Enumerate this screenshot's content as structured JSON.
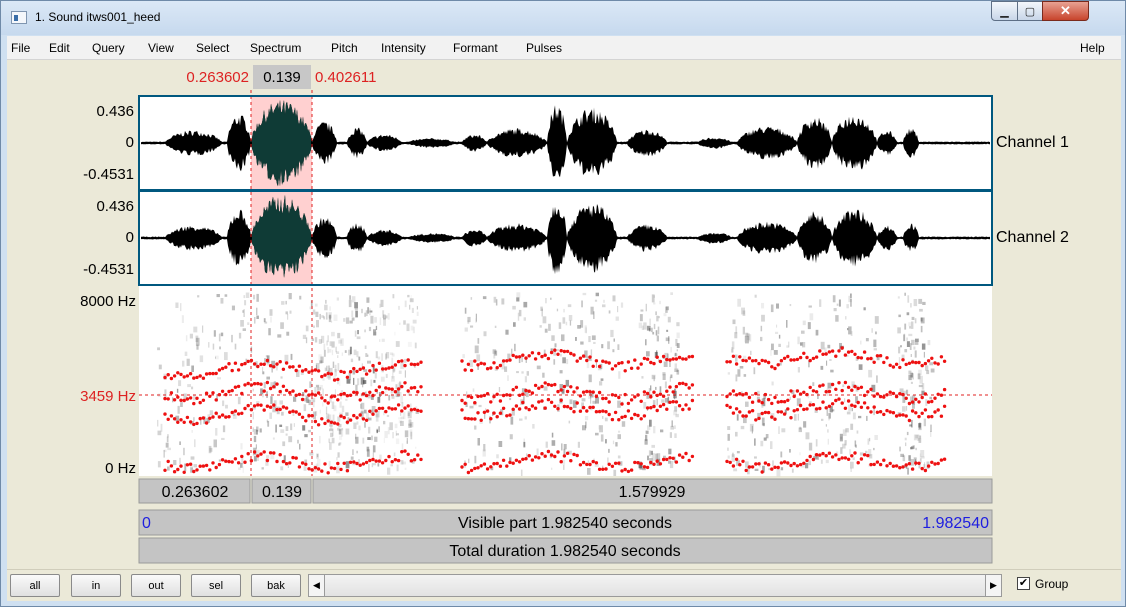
{
  "window": {
    "title": "1. Sound itws001_heed"
  },
  "menu": [
    "File",
    "Edit",
    "Query",
    "View",
    "Select",
    "Spectrum",
    "Pitch",
    "Intensity",
    "Formant",
    "Pulses"
  ],
  "help_label": "Help",
  "selection": {
    "start": "0.263602",
    "length": "0.139",
    "end": "0.402611"
  },
  "channels": [
    {
      "name": "Channel 1",
      "max": "0.436",
      "zero": "0",
      "min": "-0.4531"
    },
    {
      "name": "Channel 2",
      "max": "0.436",
      "zero": "0",
      "min": "-0.4531"
    }
  ],
  "spectrogram": {
    "top_label": "8000 Hz",
    "cursor_label": "3459 Hz",
    "bottom_label": "0 Hz"
  },
  "time_bar": {
    "left": "0.263602",
    "sel": "0.139",
    "right": "1.579929"
  },
  "visible_bar": {
    "start": "0",
    "text": "Visible part 1.982540 seconds",
    "end": "1.982540"
  },
  "total_bar": {
    "text": "Total duration 1.982540 seconds"
  },
  "buttons": [
    "all",
    "in",
    "out",
    "sel",
    "bak"
  ],
  "group_label": "Group",
  "colors": {
    "selection": "#ff0000",
    "cursor_blue": "#0000ff",
    "formant": "#ee1111",
    "panel_border": "#00587f"
  }
}
